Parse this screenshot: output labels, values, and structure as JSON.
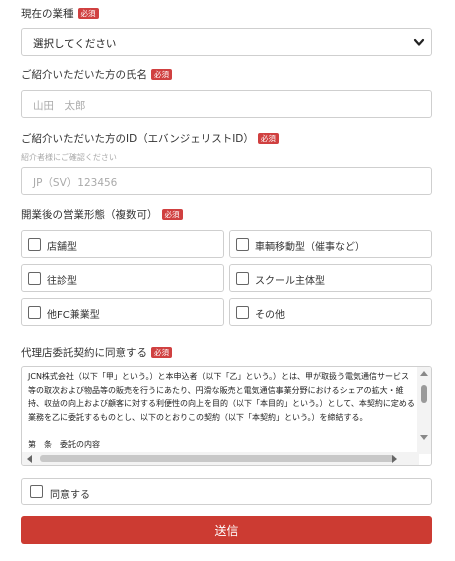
{
  "industry": {
    "label": "現在の業種",
    "required_badge": "必須",
    "select_value": "選択してください"
  },
  "referrer_name": {
    "label": "ご紹介いただいた方の氏名",
    "required_badge": "必須",
    "placeholder": "山田　太郎"
  },
  "referrer_id": {
    "label": "ご紹介いただいた方のID（エバンジェリストID）",
    "required_badge": "必須",
    "hint": "紹介者様にご確認ください",
    "placeholder": "JP（SV）123456"
  },
  "business_type": {
    "label": "開業後の営業形態（複数可）",
    "required_badge": "必須",
    "options": [
      {
        "label": "店舗型"
      },
      {
        "label": "車輌移動型（催事など）"
      },
      {
        "label": "往診型"
      },
      {
        "label": "スクール主体型"
      },
      {
        "label": "他FC兼業型"
      },
      {
        "label": "その他"
      }
    ]
  },
  "agreement": {
    "label": "代理店委託契約に同意する",
    "required_badge": "必須",
    "text": "JCN株式会社（以下「甲」という。）と本申込者（以下「乙」という。）とは、甲が取扱う電気通信サービス等の取次および物品等の販売を行うにあたり、円滑な販売と電気通信事業分野におけるシェアの拡大・維持、収益の向上および顧客に対する利便性の向上を目的（以下「本目的」という。）として、本契約に定める業務を乙に委託するものとし、以下のとおりこの契約（以下「本契約」という。）を締結する。\n\n第　条　委託の内容",
    "agree_label": "同意する"
  },
  "submit_label": "送信",
  "colors": {
    "accent": "#cc3b32",
    "required_badge": "#d04040"
  }
}
